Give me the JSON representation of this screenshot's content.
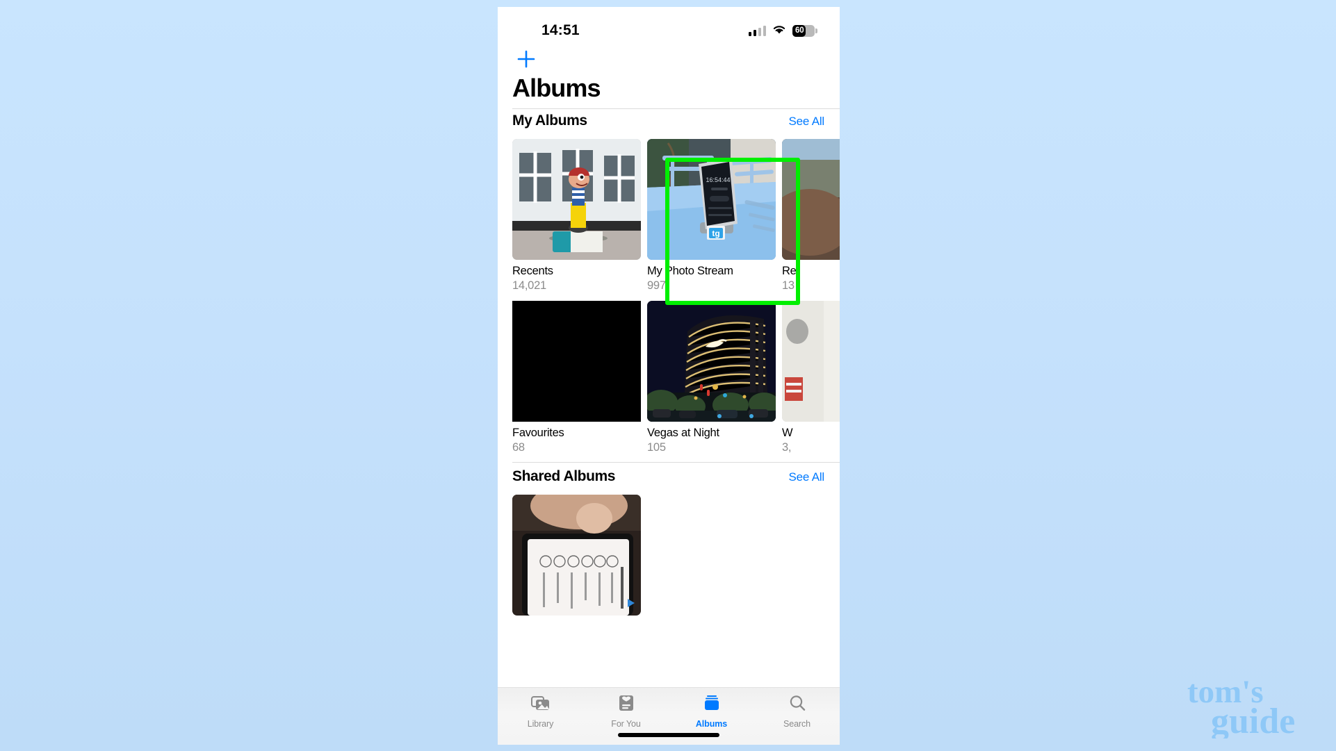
{
  "status_bar": {
    "time": "14:51",
    "battery_percent": "60",
    "signal_icon": "cellular-signal-icon",
    "wifi_icon": "wifi-icon",
    "battery_icon": "battery-icon"
  },
  "nav": {
    "add_icon": "plus-icon",
    "title": "Albums"
  },
  "sections": [
    {
      "id": "my-albums",
      "title": "My Albums",
      "see_all_label": "See All"
    },
    {
      "id": "shared-albums",
      "title": "Shared Albums",
      "see_all_label": "See All"
    }
  ],
  "my_albums": [
    {
      "name": "Recents",
      "count": "14,021"
    },
    {
      "name": "My Photo Stream",
      "count": "997"
    },
    {
      "name": "Re",
      "count": "13"
    },
    {
      "name": "Favourites",
      "count": "68"
    },
    {
      "name": "Vegas at Night",
      "count": "105"
    },
    {
      "name": "W",
      "count": "3,"
    }
  ],
  "highlight": {
    "target_album": "My Photo Stream",
    "color": "#00ef00"
  },
  "tab_bar": {
    "tabs": [
      {
        "label": "Library",
        "icon": "photos-library-icon",
        "active": false
      },
      {
        "label": "For You",
        "icon": "for-you-card-icon",
        "active": false
      },
      {
        "label": "Albums",
        "icon": "albums-stack-icon",
        "active": true
      },
      {
        "label": "Search",
        "icon": "search-magnifier-icon",
        "active": false
      }
    ],
    "active_color": "#007aff",
    "inactive_color": "#8a8a8a"
  },
  "watermark": {
    "line1": "tom's",
    "line2": "guide",
    "color": "#8ec8f7"
  },
  "theme": {
    "accent_blue": "#007aff",
    "background_top": "#c9e5fe",
    "background_bottom": "#bedcf8"
  }
}
